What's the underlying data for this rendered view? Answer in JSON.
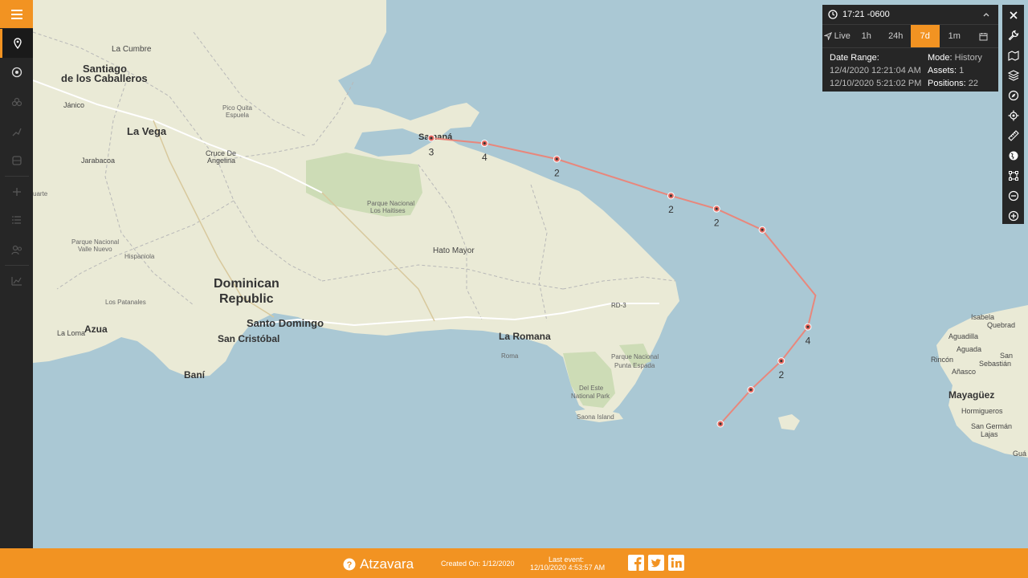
{
  "panel": {
    "time": "17:21 -0600",
    "tabs": [
      "Live",
      "1h",
      "24h",
      "7d",
      "1m"
    ],
    "date_range_label": "Date Range:",
    "start": "12/4/2020 12:21:04 AM",
    "end": "12/10/2020 5:21:02 PM",
    "mode_label": "Mode:",
    "mode_value": "History",
    "assets_label": "Assets:",
    "assets_value": "1",
    "positions_label": "Positions:",
    "positions_value": "22"
  },
  "map_labels": {
    "la_cumbre": "La Cumbre",
    "santiago1": "Santiago",
    "santiago2": "de los Caballeros",
    "janico": "Jánico",
    "pico1": "Pico Quita",
    "pico2": "Espuela",
    "la_vega": "La Vega",
    "jarabacoa": "Jarabacoa",
    "cruce1": "Cruce De",
    "cruce2": "Angelina",
    "samana": "Samaná",
    "haitises1": "Parque Nacional",
    "haitises2": "Los Haitises",
    "pn_valle1": "Parque Nacional",
    "pn_valle2": "Valle Nuevo",
    "hispaniola": "Hispaniola",
    "hato_mayor": "Hato Mayor",
    "dr1": "Dominican",
    "dr2": "Republic",
    "los_patanales": "Los Patanales",
    "rd3": "RD-3",
    "santo_domingo": "Santo Domingo",
    "la_loma": "La Loma",
    "azua": "Azua",
    "san_cristobal": "San Cristóbal",
    "la_romana": "La Romana",
    "bani": "Baní",
    "punta1": "Parque Nacional",
    "punta2": "Punta Espada",
    "del_este1": "Del Este",
    "del_este2": "National Park",
    "saona": "Saona Island",
    "isabela": "Isabela",
    "quebradillas": "Quebrad",
    "aguadilla": "Aguadilla",
    "aguada": "Aguada",
    "rincon": "Rincón",
    "san_sebastian1": "San",
    "san_sebastian2": "Sebastián",
    "anasco": "Añasco",
    "mayaguez": "Mayagüez",
    "hormigueros": "Hormigueros",
    "san_german": "San Germán",
    "lajas": "Lajas",
    "guanica": "Guá",
    "uarte": "uarte",
    "roma": "Roma"
  },
  "track_labels": [
    {
      "text": "3",
      "lon": -69.34,
      "lat": 19.19
    },
    {
      "text": "4",
      "lon": -69.2,
      "lat": 19.17
    },
    {
      "text": "2",
      "lon": -69.01,
      "lat": 19.11
    },
    {
      "text": "2",
      "lon": -68.71,
      "lat": 18.97
    },
    {
      "text": "2",
      "lon": -68.59,
      "lat": 18.92
    },
    {
      "text": "4",
      "lon": -68.35,
      "lat": 18.47
    },
    {
      "text": "2",
      "lon": -68.42,
      "lat": 18.34
    }
  ],
  "track": [
    {
      "lon": -69.34,
      "lat": 19.2
    },
    {
      "lon": -69.2,
      "lat": 19.18
    },
    {
      "lon": -69.01,
      "lat": 19.12
    },
    {
      "lon": -68.71,
      "lat": 18.98
    },
    {
      "lon": -68.59,
      "lat": 18.93
    },
    {
      "lon": -68.47,
      "lat": 18.85
    },
    {
      "lon": -68.33,
      "lat": 18.6
    },
    {
      "lon": -68.35,
      "lat": 18.48
    },
    {
      "lon": -68.42,
      "lat": 18.35
    },
    {
      "lon": -68.5,
      "lat": 18.24
    },
    {
      "lon": -68.58,
      "lat": 18.11
    }
  ],
  "footer": {
    "brand": "Atzavara",
    "created": "Created On: 1/12/2020",
    "last_event_label": "Last event:",
    "last_event_value": "12/10/2020 4:53:57 AM"
  },
  "colors": {
    "accent": "#f29322",
    "track": "#e8877c",
    "dark": "#262626",
    "land": "#eaead6",
    "sea": "#aac8d4",
    "park": "#cddcb6"
  },
  "icons": {
    "menu": "menu-icon",
    "side": [
      "map-pin-icon",
      "target-icon",
      "group-icon",
      "route-icon",
      "geofence-icon",
      "plus-icon",
      "list-icon",
      "users-icon",
      "chart-icon"
    ],
    "tools": [
      "close-icon",
      "wrench-icon",
      "map-layers-icon",
      "stack-icon",
      "compass-icon",
      "locate-icon",
      "ruler-icon",
      "globe-icon",
      "select-area-icon",
      "zoom-out-icon",
      "zoom-in-icon"
    ],
    "social": [
      "facebook-icon",
      "twitter-icon",
      "linkedin-icon"
    ]
  }
}
